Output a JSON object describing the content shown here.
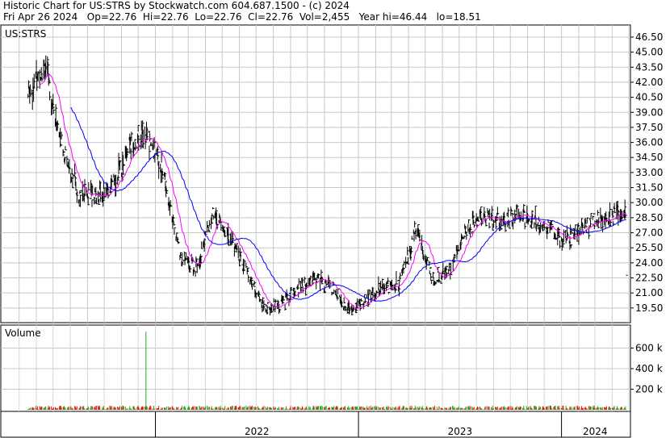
{
  "header": {
    "title": "Historic Chart for US:STRS by Stockwatch.com 604.687.1500 - (c) 2024",
    "stats": "Fri Apr 26 2024   Op=22.76  Hi=22.76  Lo=22.76  Cl=22.76  Vol=2,455   Year hi=46.44   lo=18.51"
  },
  "chart_data": [
    {
      "type": "ohlc",
      "symbol": "US:STRS",
      "title": "US:STRS",
      "y_ticks": [
        19.5,
        21.0,
        22.5,
        24.0,
        25.5,
        27.0,
        28.5,
        30.0,
        31.5,
        33.0,
        34.5,
        36.0,
        37.5,
        39.0,
        40.5,
        42.0,
        43.5,
        45.0,
        46.5
      ],
      "ylim": [
        18.2,
        47.3
      ],
      "x_period_labels": [
        "2022",
        "2023",
        "2024"
      ],
      "grid": true,
      "last_bar": {
        "date": "2024-04-26",
        "open": 22.76,
        "high": 22.76,
        "low": 22.76,
        "close": 22.76
      },
      "year_high": 46.44,
      "year_low": 18.51,
      "series": [
        {
          "name": "price",
          "color": "#000000",
          "x": [
            "2021-05",
            "2021-06",
            "2021-07",
            "2021-08",
            "2021-09",
            "2021-10",
            "2021-11",
            "2021-12",
            "2022-01",
            "2022-02",
            "2022-03",
            "2022-04",
            "2022-05",
            "2022-06",
            "2022-07",
            "2022-08",
            "2022-09",
            "2022-10",
            "2022-11",
            "2022-12",
            "2023-01",
            "2023-02",
            "2023-03",
            "2023-04",
            "2023-05",
            "2023-06",
            "2023-07",
            "2023-08",
            "2023-09",
            "2023-10",
            "2023-11",
            "2023-12",
            "2024-01",
            "2024-02",
            "2024-03",
            "2024-04"
          ],
          "y": [
            40.5,
            44.0,
            36.0,
            31.0,
            30.8,
            31.5,
            35.5,
            37.0,
            33.0,
            24.5,
            23.5,
            29.0,
            26.5,
            23.0,
            19.4,
            19.8,
            21.5,
            22.5,
            21.5,
            19.3,
            20.5,
            21.5,
            22.0,
            27.5,
            22.2,
            23.5,
            27.5,
            28.5,
            28.0,
            28.8,
            28.2,
            27.2,
            26.2,
            28.0,
            28.5,
            29.0
          ]
        },
        {
          "name": "short moving average",
          "color": "#ff00ff"
        },
        {
          "name": "long moving average",
          "color": "#0000ff"
        }
      ]
    },
    {
      "type": "bar",
      "title": "Volume",
      "y_ticks": [
        "200 k",
        "400 k",
        "600 k"
      ],
      "ylim": [
        0,
        800
      ],
      "up_color": "#22aa22",
      "down_color": "#ee1111",
      "spike": {
        "x": "2021-12",
        "value": 760
      }
    }
  ]
}
